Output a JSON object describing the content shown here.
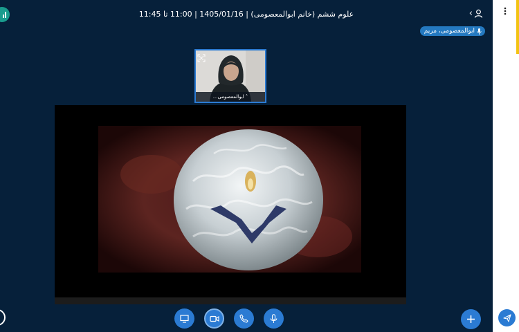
{
  "header": {
    "title": "علوم ششم (خانم ابوالمعصومی) | 1405/01/16 | 11:00 تا 11:45"
  },
  "talking_indicator": {
    "name": "ابوالمعصومی، مریم"
  },
  "webcam": {
    "name": "ابوالمعصومی..."
  },
  "controls": {
    "buttons": [
      {
        "icon": "screen-share-icon"
      },
      {
        "icon": "video-camera-icon"
      },
      {
        "icon": "phone-icon"
      },
      {
        "icon": "microphone-icon"
      }
    ],
    "actions_icon": "plus-icon"
  },
  "colors": {
    "background": "#06203a",
    "accent": "#2b7bd3",
    "stats": "#1a9c8e",
    "chat_panel": "#ffffff",
    "notice_bar": "#f3c313"
  }
}
